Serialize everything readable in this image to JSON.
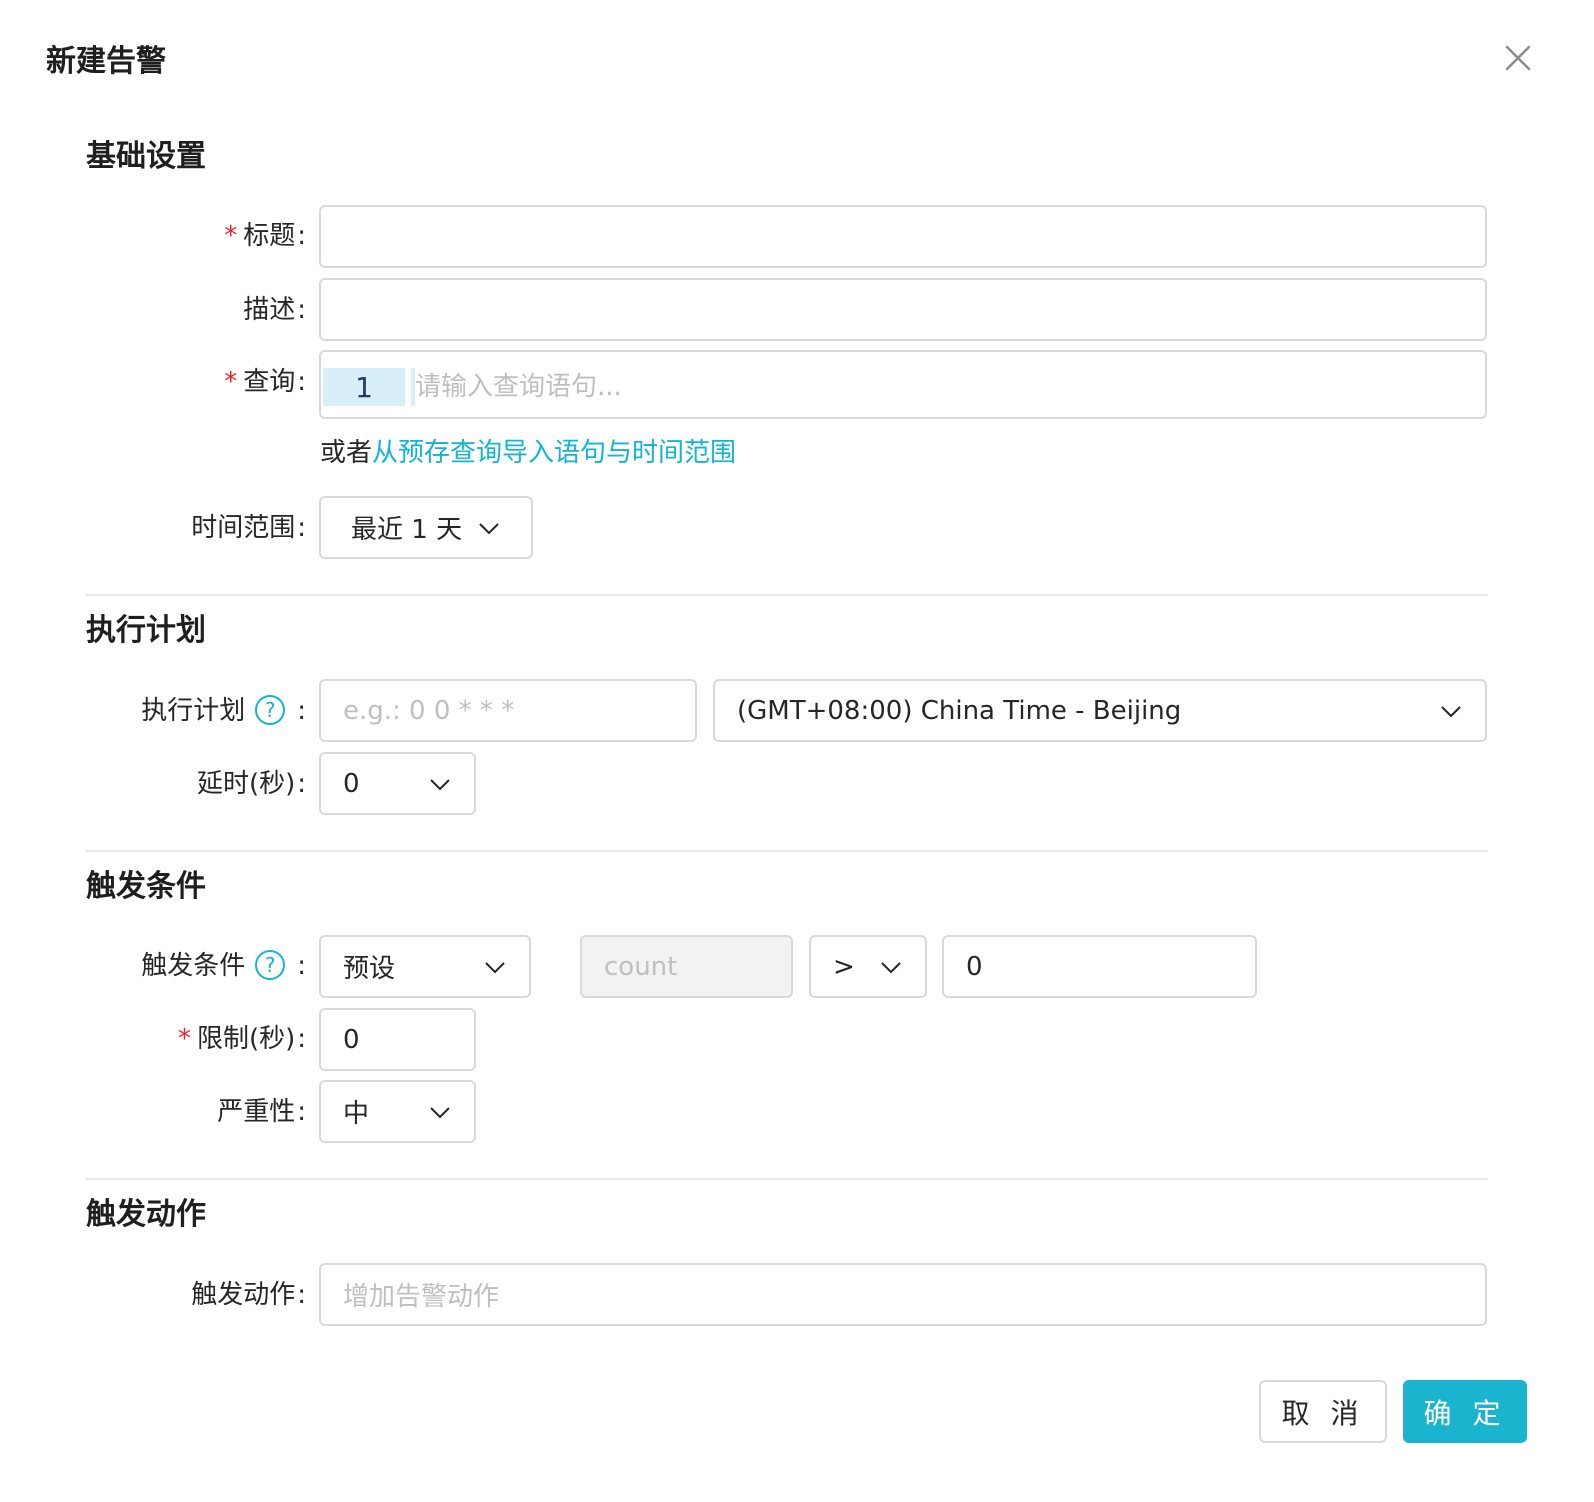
{
  "modal": {
    "title": "新建告警"
  },
  "sections": {
    "basic": {
      "title": "基础设置"
    },
    "schedule": {
      "title": "执行计划"
    },
    "trigger": {
      "title": "触发条件"
    },
    "action": {
      "title": "触发动作"
    }
  },
  "fields": {
    "title": {
      "label": "标题",
      "value": ""
    },
    "description": {
      "label": "描述",
      "value": ""
    },
    "query": {
      "label": "查询",
      "line_number": "1",
      "placeholder": "请输入查询语句...",
      "helper_prefix": "或者",
      "helper_link": "从预存查询导入语句与时间范围"
    },
    "time_range": {
      "label": "时间范围",
      "value": "最近 1 天"
    },
    "schedule": {
      "label": "执行计划",
      "placeholder": "e.g.: 0 0 * * *",
      "timezone": "(GMT+08:00) China Time - Beijing"
    },
    "delay": {
      "label": "延时(秒)",
      "value": "0"
    },
    "trigger": {
      "label": "触发条件",
      "mode": "预设",
      "field_placeholder": "count",
      "operator": ">",
      "threshold": "0"
    },
    "limit": {
      "label": "限制(秒)",
      "value": "0"
    },
    "severity": {
      "label": "严重性",
      "value": "中"
    },
    "action": {
      "label": "触发动作",
      "placeholder": "增加告警动作"
    }
  },
  "footer": {
    "cancel_label": "取 消",
    "ok_label": "确 定"
  },
  "colors": {
    "accent": "#1ab4cf",
    "required": "#f5222d",
    "border": "#d9d9d9",
    "disabled_bg": "#f2f2f2"
  },
  "icons": {
    "close": "close-icon",
    "help": "question-circle-icon",
    "dropdown": "chevron-down-icon"
  }
}
